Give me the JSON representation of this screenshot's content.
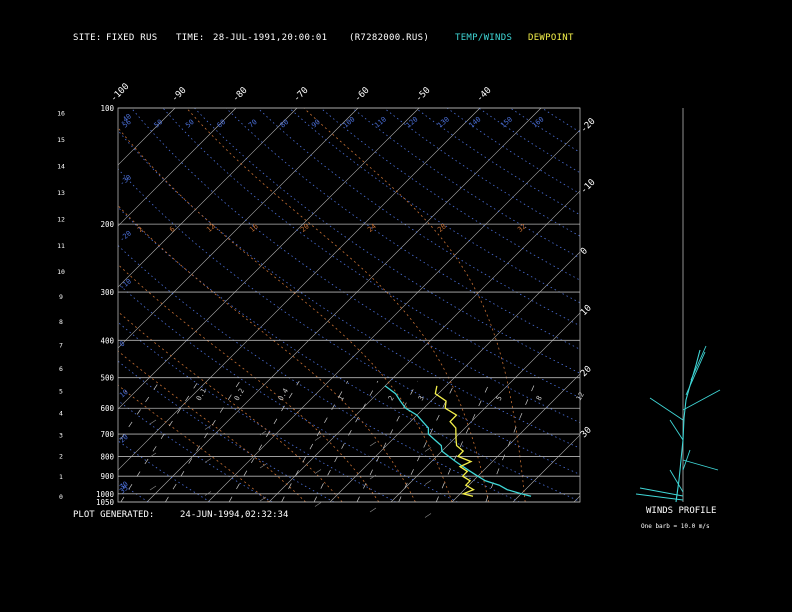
{
  "header": {
    "site_label": "SITE:",
    "site_value": "FIXED RUS",
    "time_label": "TIME:",
    "time_value": "28-JUL-1991,20:00:01",
    "file_value": "(R7282000.RUS)",
    "legend_temp": "TEMP/WINDS",
    "legend_dew": "DEWPOINT"
  },
  "footer": {
    "generated_label": "PLOT GENERATED:",
    "generated_value": "24-JUN-1994,02:32:34"
  },
  "wind_profile": {
    "title": "WINDS PROFILE",
    "subtitle": "One barb = 10.0 m/s"
  },
  "colors": {
    "temp": "#3fd7d7",
    "dewpoint": "#f4f04a",
    "dry_adiabat": "#4b6fd8",
    "moist_adiabat": "#c56f33",
    "mixing_ratio": "#c8c8c8",
    "grid": "#b4b4b4"
  },
  "chart_data": {
    "type": "line",
    "title": "",
    "pressure_labels": [
      100,
      200,
      300,
      400,
      500,
      600,
      700,
      800,
      900,
      1000,
      1050
    ],
    "height_km_labels": [
      0,
      1,
      2,
      3,
      4,
      5,
      6,
      7,
      8,
      9,
      10,
      11,
      12,
      13,
      14,
      15,
      16
    ],
    "skew_temp_labels_top": [
      -110,
      -100,
      -90,
      -80,
      -70,
      -60,
      -50,
      -40
    ],
    "skew_temp_labels_right": [
      -30,
      -20,
      -10,
      0,
      10,
      20,
      30
    ],
    "dry_adiabat_labels": [
      56,
      50,
      50,
      60,
      70,
      80,
      90,
      100,
      110,
      120,
      130,
      140,
      150,
      160
    ],
    "dry_adiabat_left_labels": [
      -40,
      -30,
      -20,
      -10,
      0,
      10,
      20,
      30,
      35
    ],
    "moist_adiabat_labels": [
      2,
      6,
      12,
      16,
      20,
      24,
      28,
      32
    ],
    "mixing_ratio_labels": [
      0.1,
      0.2,
      0.4,
      1.0,
      2.0,
      3.0,
      5.0,
      8.0,
      12.0
    ],
    "temperature_profile": {
      "name": "TEMP/WINDS",
      "pressure": [
        1014,
        1000,
        975,
        950,
        925,
        900,
        875,
        850,
        825,
        800,
        775,
        750,
        725,
        700,
        675,
        650,
        625,
        600,
        575,
        550,
        525
      ],
      "temp": [
        32,
        30,
        27,
        25,
        22,
        20,
        18,
        16,
        14,
        12,
        10,
        9,
        7,
        5,
        4,
        2,
        0,
        -3,
        -5,
        -7,
        -10
      ]
    },
    "dewpoint_profile": {
      "name": "DEWPOINT",
      "pressure": [
        1014,
        1000,
        975,
        950,
        925,
        900,
        875,
        850,
        825,
        800,
        775,
        750,
        725,
        700,
        675,
        650,
        625,
        600,
        575,
        550,
        525
      ],
      "dewpoint": [
        22,
        21,
        21,
        20,
        19,
        18,
        17,
        16,
        16,
        14,
        13,
        12,
        10,
        10,
        8,
        7,
        6,
        4,
        2,
        0,
        -2
      ]
    }
  }
}
